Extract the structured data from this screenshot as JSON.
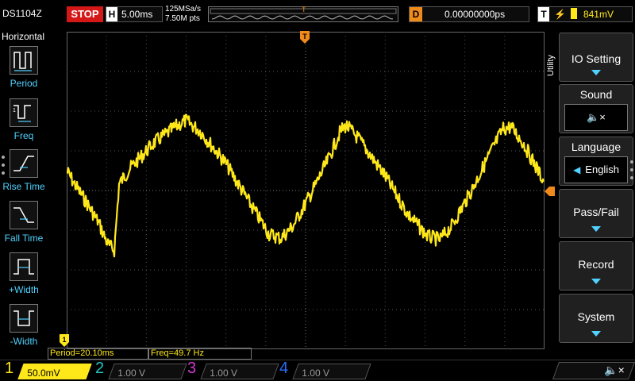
{
  "topbar": {
    "model": "DS1104Z",
    "run_state": "STOP",
    "horizontal_label": "H",
    "timebase": "5.00ms",
    "sample_rate": "125MSa/s",
    "memory_depth": "7.50M pts",
    "trigger_marker": "T",
    "delay_label": "D",
    "delay_value": "0.00000000ps",
    "trigger_label": "T",
    "trigger_edge_icon": "rising-edge-icon",
    "trigger_level": "841mV"
  },
  "left_panel": {
    "title": "Horizontal",
    "items": [
      {
        "label": "Period",
        "icon": "period-icon"
      },
      {
        "label": "Freq",
        "icon": "freq-icon"
      },
      {
        "label": "Rise Time",
        "icon": "rise-time-icon"
      },
      {
        "label": "Fall Time",
        "icon": "fall-time-icon"
      },
      {
        "label": "+Width",
        "icon": "positive-width-icon"
      },
      {
        "label": "-Width",
        "icon": "negative-width-icon"
      }
    ]
  },
  "measurements": {
    "period": "Period=20.10ms",
    "freq": "Freq=49.7 Hz"
  },
  "right_menu": {
    "title": "Utility",
    "io_setting": "IO Setting",
    "sound": "Sound",
    "sound_icon": "speaker-muted-icon",
    "sound_glyph": "🔈×",
    "language": "Language",
    "language_value": "English",
    "pass_fail": "Pass/Fail",
    "record": "Record",
    "system": "System"
  },
  "channels": [
    {
      "num": "1",
      "scale": "50.0mV",
      "color": "#ffe81a",
      "active": true
    },
    {
      "num": "2",
      "scale": "1.00 V",
      "color": "#23c3c3",
      "active": false
    },
    {
      "num": "3",
      "scale": "1.00 V",
      "color": "#d437d4",
      "active": false
    },
    {
      "num": "4",
      "scale": "1.00 V",
      "color": "#2a6cff",
      "active": false
    }
  ],
  "bottom": {
    "speaker_glyph": "🔈×",
    "speaker_icon": "speaker-muted-icon"
  },
  "colors": {
    "ch1": "#ffe81a",
    "trigger": "#f08a1a",
    "accent": "#4fd2ff",
    "stop": "#d41818"
  }
}
